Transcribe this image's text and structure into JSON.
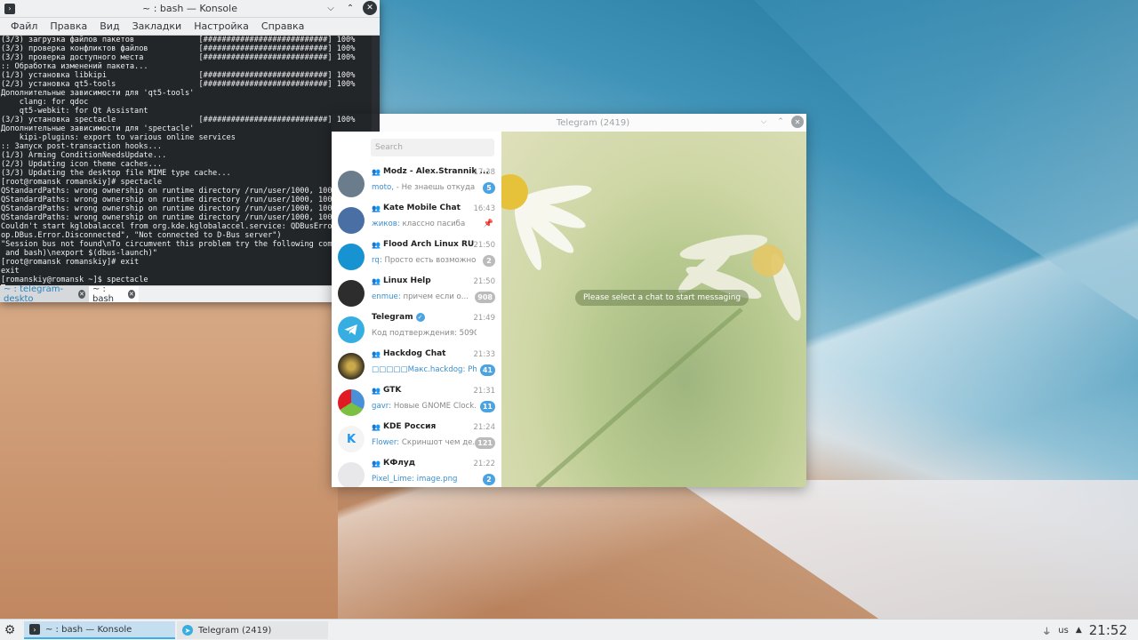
{
  "konsole": {
    "title": "~ : bash — Konsole",
    "menus": [
      "Файл",
      "Правка",
      "Вид",
      "Закладки",
      "Настройка",
      "Справка"
    ],
    "terminal_lines": [
      "(3/3) загрузка файлов пакетов              [###########################] 100%",
      "(3/3) проверка конфликтов файлов           [###########################] 100%",
      "(3/3) проверка доступного места            [###########################] 100%",
      ":: Обработка изменений пакета...",
      "(1/3) установка libkipi                    [###########################] 100%",
      "(2/3) установка qt5-tools                  [###########################] 100%",
      "Дополнительные зависимости для 'qt5-tools'",
      "    clang: for qdoc",
      "    qt5-webkit: for Qt Assistant",
      "(3/3) установка spectacle                  [###########################] 100%",
      "Дополнительные зависимости для 'spectacle'",
      "    kipi-plugins: export to various online services",
      ":: Запуск post-transaction hooks...",
      "(1/3) Arming ConditionNeedsUpdate...",
      "(2/3) Updating icon theme caches...",
      "(3/3) Updating the desktop file MIME type cache...",
      "[root@romansk romanskiy]# spectacle",
      "QStandardPaths: wrong ownership on runtime directory /run/user/1000, 1000 instead of 0",
      "QStandardPaths: wrong ownership on runtime directory /run/user/1000, 1000 instead of 0",
      "QStandardPaths: wrong ownership on runtime directory /run/user/1000, 1000 instead of 0",
      "QStandardPaths: wrong ownership on runtime directory /run/user/1000, 1000 instead of 0",
      "Couldn't start kglobalaccel from org.kde.kglobalaccel.service: QDBusError(\"org.freedesk",
      "op.DBus.Error.Disconnected\", \"Not connected to D-Bus server\")",
      "\"Session bus not found\\nTo circumvent this problem try the following command (with Linux",
      " and bash)\\nexport $(dbus-launch)\"",
      "[root@romansk romanskiy]# exit",
      "exit",
      "[romanskiy@romansk ~]$ spectacle"
    ],
    "tabs": [
      {
        "label": "~ : telegram-deskto"
      },
      {
        "label": "~ : bash"
      }
    ]
  },
  "telegram": {
    "title": "Telegram (2419)",
    "search_placeholder": "Search",
    "hint": "Please select a chat to start messaging",
    "chats": [
      {
        "name": "Modz - Alex.Strannik ...",
        "time": "17:38",
        "sender": "moto,",
        "message": " - Не знаешь откуда ...",
        "badge": "5",
        "badge_color": "blue",
        "group": true
      },
      {
        "name": "Kate Mobile Chat",
        "time": "16:43",
        "sender": "жиков:",
        "message": " классно пасиба",
        "badge": "",
        "badge_color": "",
        "pinned": true,
        "group": true
      },
      {
        "name": "Flood Arch Linux RU",
        "time": "21:50",
        "sender": "rq:",
        "message": " Просто есть возможно...",
        "badge": "2",
        "badge_color": "grey",
        "group": true
      },
      {
        "name": "Linux Help",
        "time": "21:50",
        "sender": "enmue:",
        "message": " причем если о...",
        "badge": "908",
        "badge_color": "grey",
        "group": true
      },
      {
        "name": "Telegram",
        "time": "21:49",
        "sender": "",
        "message": "Код подтверждения: 50903. Ни...",
        "badge": "",
        "badge_color": "",
        "verified": true,
        "group": false
      },
      {
        "name": "Hackdog Chat",
        "time": "21:33",
        "sender": "□□□□□Макс.hackdog:",
        "message": " Photo",
        "badge": "41",
        "badge_color": "blue",
        "group": true
      },
      {
        "name": "GTK",
        "time": "21:31",
        "sender": "gavr:",
        "message": " Новые GNOME Clock...",
        "badge": "11",
        "badge_color": "blue",
        "group": true
      },
      {
        "name": "KDE Россия",
        "time": "21:24",
        "sender": "Flower:",
        "message": " Скриншот чем де...",
        "badge": "121",
        "badge_color": "grey",
        "group": true
      },
      {
        "name": "КФлуд",
        "time": "21:22",
        "sender": "Pixel_Lime:",
        "message": " image.png",
        "badge": "2",
        "badge_color": "blue",
        "group": true
      }
    ]
  },
  "taskbar": {
    "tasks": [
      {
        "label": "~ : bash — Konsole"
      },
      {
        "label": "Telegram (2419)"
      }
    ],
    "lang": "us",
    "clock": "21:52"
  },
  "colors": {
    "accent": "#3daee9",
    "telegram_blue": "#4ba3e2",
    "terminal_bg": "#232629"
  }
}
